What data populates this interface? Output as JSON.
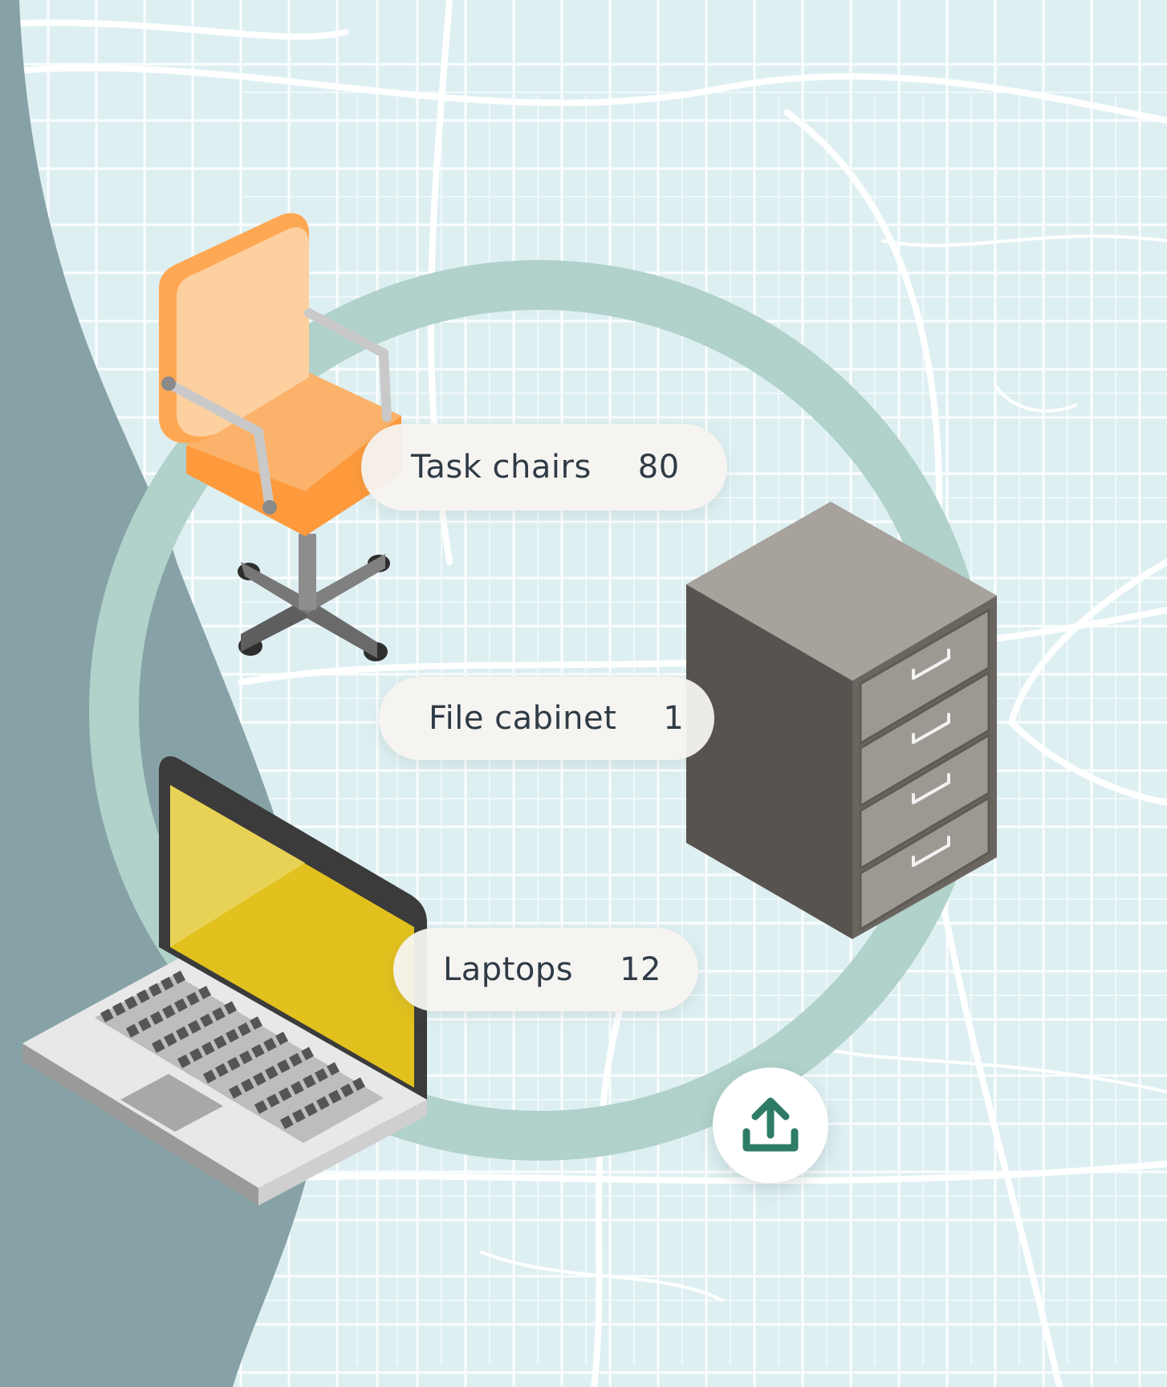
{
  "inventory": {
    "items": [
      {
        "label": "Task chairs",
        "count": "80"
      },
      {
        "label": "File cabinet",
        "count": "1"
      },
      {
        "label": "Laptops",
        "count": "12"
      }
    ]
  },
  "icons": {
    "chair": "office-chair-icon",
    "cabinet": "file-cabinet-icon",
    "laptop": "laptop-icon",
    "upload": "upload-icon"
  },
  "colors": {
    "map_background": "#deeff2",
    "map_roads": "#ffffff",
    "side_panel": "#86a2a6",
    "ring": "#b1d1cb",
    "upload_accent": "#2e7b68",
    "chair_orange": "#fbb26a",
    "laptop_screen": "#e4c72a",
    "cabinet_gray": "#5a5550"
  }
}
